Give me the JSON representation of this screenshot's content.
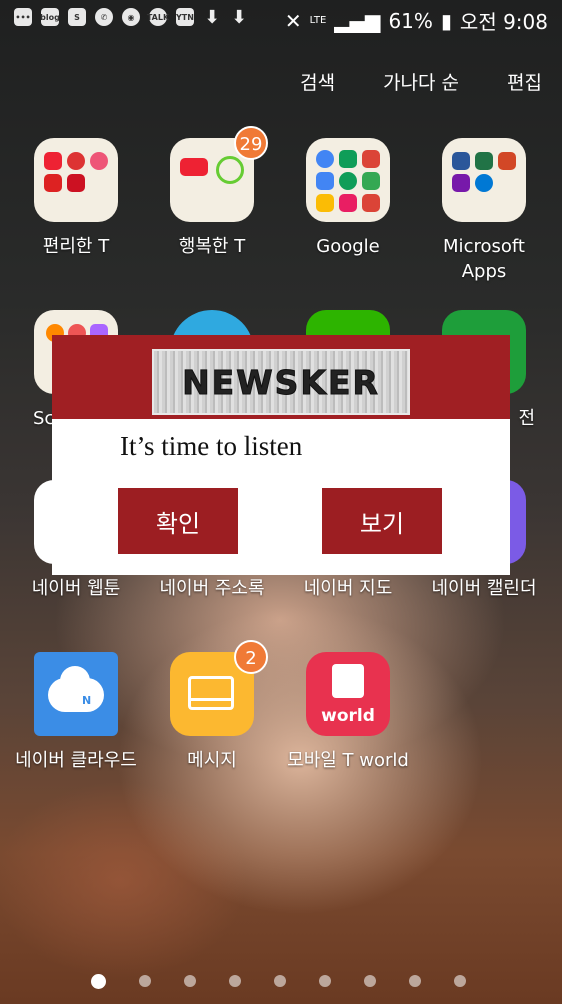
{
  "status": {
    "left_icons": [
      "•••",
      "blog",
      "S",
      "✆",
      "◉",
      "TALK",
      "YTN",
      "⬇",
      "⬇"
    ],
    "network": "LTE",
    "battery": "61%",
    "time": "오전 9:08"
  },
  "top_menu": {
    "search": "검색",
    "sort": "가나다 순",
    "edit": "편집"
  },
  "apps": {
    "folder1": {
      "label": "편리한 T"
    },
    "folder2": {
      "label": "행복한 T",
      "badge": "29"
    },
    "google": {
      "label": "Google"
    },
    "microsoft": {
      "label": "Microsoft Apps"
    },
    "row2_1": {
      "label": "Sc"
    },
    "row2_4": {
      "label": "전"
    },
    "webtoon": {
      "label": "네이버 웹툰"
    },
    "contacts": {
      "label": "네이버 주소록"
    },
    "map": {
      "label": "네이버 지도"
    },
    "calendar": {
      "label": "네이버 캘린더"
    },
    "cloud": {
      "label": "네이버 클라우드"
    },
    "messages": {
      "label": "메시지",
      "badge": "2"
    },
    "tworld": {
      "label": "모바일 T world",
      "icon_text": "world"
    }
  },
  "dialog": {
    "logo": "NEWSKER",
    "message": "It’s time to listen",
    "confirm": "확인",
    "view": "보기"
  },
  "pages": {
    "count": 9,
    "active": 0
  }
}
